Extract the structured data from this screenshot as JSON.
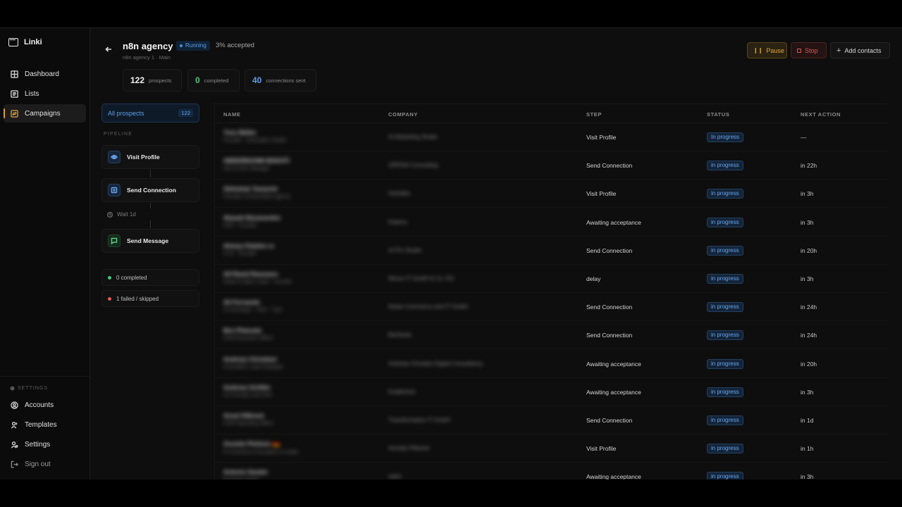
{
  "app": {
    "name": "Linki"
  },
  "sidebar": {
    "nav": [
      {
        "label": "Dashboard",
        "icon": "dashboard-icon"
      },
      {
        "label": "Lists",
        "icon": "list-icon"
      },
      {
        "label": "Campaigns",
        "icon": "campaign-icon",
        "active": true
      }
    ],
    "settings_label": "SETTINGS",
    "bottom": [
      {
        "label": "Accounts",
        "icon": "account-icon"
      },
      {
        "label": "Templates",
        "icon": "template-icon"
      },
      {
        "label": "Settings",
        "icon": "gear-icon"
      },
      {
        "label": "Sign out",
        "icon": "sign-out-icon"
      }
    ]
  },
  "header": {
    "title": "n8n agency",
    "status": "Running",
    "accepted": "3% accepted",
    "subtitle": "n8n agency 1 · Main",
    "buttons": {
      "pause": "Pause",
      "stop": "Stop",
      "add": "Add contacts"
    },
    "stats": [
      {
        "value": "122",
        "label": "prospects"
      },
      {
        "value": "0",
        "label": "completed"
      },
      {
        "value": "40",
        "label": "connections sent"
      }
    ]
  },
  "pipeline": {
    "all_label": "All prospects",
    "all_count": "122",
    "section_label": "PIPELINE",
    "steps": [
      {
        "label": "Visit Profile",
        "icon": "eye-icon"
      },
      {
        "label": "Send Connection",
        "icon": "connection-icon"
      },
      {
        "label": "Send Message",
        "icon": "message-icon"
      }
    ],
    "wait_label": "Wait 1d",
    "summary": [
      {
        "label": "0 completed"
      },
      {
        "label": "1 failed / skipped"
      }
    ]
  },
  "table": {
    "columns": [
      "NAME",
      "COMPANY",
      "STEP",
      "STATUS",
      "NEXT ACTION"
    ],
    "rows": [
      {
        "name": "Yves Müller",
        "sub": "Founder · Automation Studio",
        "company": "AI Marketing Studio",
        "step": "Visit Profile",
        "status": "In progress",
        "next": "—"
      },
      {
        "name": "ABDERRAHIM MOKHTI",
        "sub": "n8n & Zoho Manager",
        "company": "OPENAI Consulting",
        "step": "Send Connection",
        "status": "in progress",
        "next": "in 22h"
      },
      {
        "name": "Abhishek Tewarish",
        "sub": "Founder of Automation agency",
        "company": "Autolabs",
        "step": "Visit Profile",
        "status": "in progress",
        "next": "in 3h"
      },
      {
        "name": "Akaash Basavandra",
        "sub": "CEO · Founder",
        "company": "Kalamu",
        "step": "Awaiting acceptance",
        "status": "in progress",
        "next": "in 3h"
      },
      {
        "name": "Ahmey Palahm ra",
        "sub": "CTO · Founder",
        "company": "AI Pro Studio",
        "step": "Send Connection",
        "status": "in progress",
        "next": "in 20h"
      },
      {
        "name": "Alf Rasid Rasmann",
        "sub": "Head of Sales Leads · Founder",
        "company": "Nexus IT GmbH & Co. KG",
        "step": "delay",
        "status": "in progress",
        "next": "in 3h"
      },
      {
        "name": "Ali Fernando",
        "sub": "AI Developer · CEO · Tutor",
        "company": "Nuber Commerce and IT GmbH",
        "step": "Send Connection",
        "status": "in progress",
        "next": "in 24h"
      },
      {
        "name": "Ben Platsudo",
        "sub": "Chief Executive Officer",
        "company": "Benfootic",
        "step": "Send Connection",
        "status": "in progress",
        "next": "in 24h"
      },
      {
        "name": "Andreas Christiani",
        "sub": "Consultant, Lead Strategist",
        "company": "Andreas Christian Digital Consultancy",
        "step": "Awaiting acceptance",
        "status": "in progress",
        "next": "in 20h"
      },
      {
        "name": "Andreas Schiller",
        "sub": "CO Founder and CEO",
        "company": "Erablished",
        "step": "Awaiting acceptance",
        "status": "in progress",
        "next": "in 3h"
      },
      {
        "name": "Ansel Hilbrant",
        "sub": "Chief Operating Officer",
        "company": "Transformation IT GmbH",
        "step": "Send Connection",
        "status": "in progress",
        "next": "in 1d"
      },
      {
        "name": "Annette Pleitmer 🇩🇪",
        "sub": "E-Commerce Consultant & Leader",
        "company": "Annette Pfleimer",
        "step": "Visit Profile",
        "status": "in progress",
        "next": "in 1h"
      },
      {
        "name": "Antonio Sander",
        "sub": "Business Owner",
        "company": "sales",
        "step": "Awaiting acceptance",
        "status": "in progress",
        "next": "in 3h"
      }
    ]
  }
}
